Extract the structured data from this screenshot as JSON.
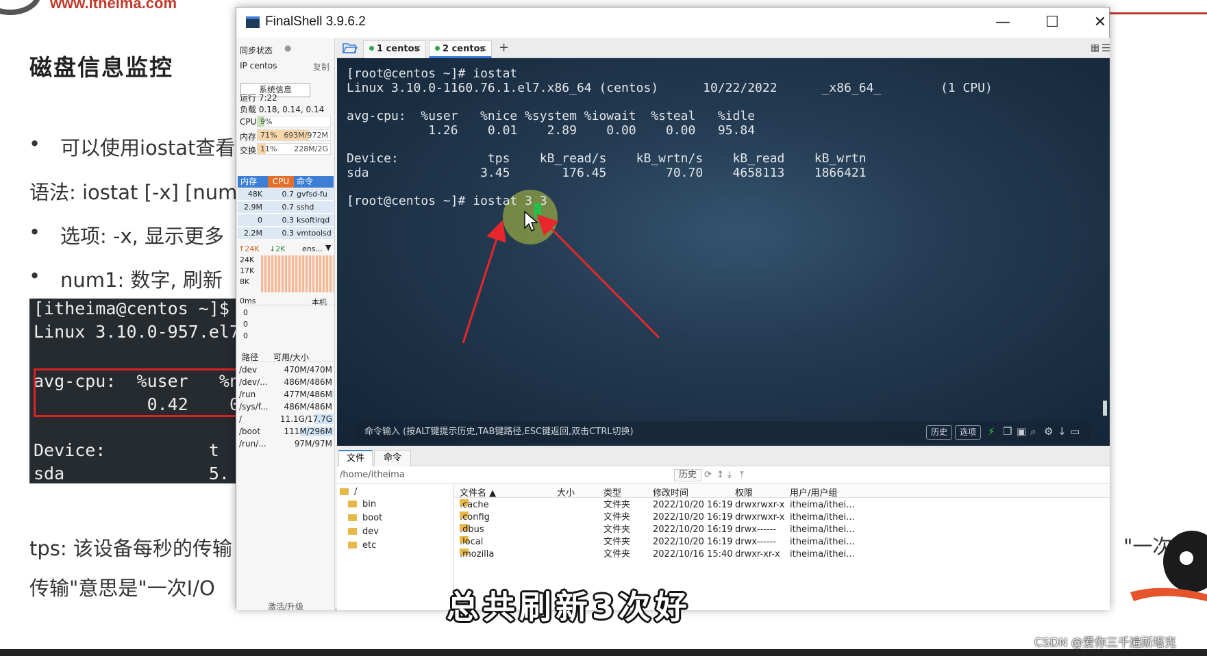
{
  "slide": {
    "logo_url": "www.itheima.com",
    "title": "磁盘信息监控",
    "bullet1": "可以使用iostat查看",
    "syntax": "语法: iostat [-x] [num",
    "bullet2": "选项: -x, 显示更多",
    "bullet3": "num1: 数字, 刷新",
    "code_line1": "[itheima@centos ~]$",
    "code_line2": "Linux 3.10.0-957.el7",
    "code_line3": "avg-cpu:  %user   %n",
    "code_line4": "           0.42    0",
    "code_line5": "Device:          t",
    "code_line6": "sda              5.",
    "tps_line": "tps: 该设备每秒的传输",
    "tps_line2": "传输\"意思是\"一次I/O",
    "right_text": "\"一次",
    "subtitle": "总共刷新3次好",
    "watermark": "CSDN @爱你三千遍斯塔克"
  },
  "window": {
    "title": "FinalShell 3.9.6.2",
    "minimize": "—",
    "maximize": "☐",
    "close": "✕"
  },
  "sidebar": {
    "sync_label": "同步状态",
    "ip_label": "IP centos",
    "copy_label": "复制",
    "sysinfo_button": "系统信息",
    "uptime": "运行 7:22",
    "load": "负载 0.18, 0.14, 0.14",
    "cpu": {
      "label": "CPU",
      "pct": "9%",
      "fraction": 0.09
    },
    "mem": {
      "label": "内存",
      "pct": "71%",
      "value": "693M/972M",
      "fraction": 0.71
    },
    "swap": {
      "label": "交换",
      "pct": "11%",
      "value": "228M/2G",
      "fraction": 0.11
    },
    "proc_headers": [
      "内存",
      "CPU",
      "命令"
    ],
    "processes": [
      {
        "mem": "48K",
        "cpu": "0.7",
        "cmd": "gvfsd-fu"
      },
      {
        "mem": "2.9M",
        "cpu": "0.7",
        "cmd": "sshd"
      },
      {
        "mem": "0",
        "cpu": "0.3",
        "cmd": "ksoftirqd"
      },
      {
        "mem": "2.2M",
        "cpu": "0.3",
        "cmd": "vmtoolsd"
      }
    ],
    "net_up": "↑24K",
    "net_down": "↓2K",
    "net_iface": "ens...",
    "net_scale": [
      "24K",
      "17K",
      "8K"
    ],
    "ping_label": "0ms",
    "ping_host": "本机",
    "ping_values": [
      "0",
      "0",
      "0"
    ],
    "disk_headers": [
      "路径",
      "可用/大小"
    ],
    "disks": [
      {
        "path": "/dev",
        "size": "470M/470M",
        "fraction": 0.0
      },
      {
        "path": "/dev/...",
        "size": "486M/486M",
        "fraction": 0.0
      },
      {
        "path": "/run",
        "size": "477M/486M",
        "fraction": 0.02
      },
      {
        "path": "/sys/f...",
        "size": "486M/486M",
        "fraction": 0.0
      },
      {
        "path": "/",
        "size": "11.1G/17.7G",
        "fraction": 0.37
      },
      {
        "path": "/boot",
        "size": "111M/296M",
        "fraction": 0.62
      },
      {
        "path": "/run/...",
        "size": "97M/97M",
        "fraction": 0.0
      }
    ],
    "activate": "激活/升级"
  },
  "tabs": [
    {
      "label": "1 centos",
      "active": false
    },
    {
      "label": "2 centos",
      "active": true
    }
  ],
  "add_tab": "+",
  "terminal": {
    "lines": [
      "[root@centos ~]# iostat",
      "Linux 3.10.0-1160.76.1.el7.x86_64 (centos)      10/22/2022      _x86_64_        (1 CPU)",
      "",
      "avg-cpu:  %user   %nice %system %iowait  %steal   %idle",
      "           1.26    0.01    2.89    0.00    0.00   95.84",
      "",
      "Device:            tps    kB_read/s    kB_wrtn/s    kB_read    kB_wrtn",
      "sda               3.45       176.45        70.70    4658113    1866421",
      "",
      "[root@centos ~]# iostat 3 3"
    ],
    "cmd_hint": "命令输入 (按ALT键提示历史,TAB键路径,ESC键返回,双击CTRL切换)",
    "history_button": "历史",
    "options_button": "选项"
  },
  "files": {
    "tab_files": "文件",
    "tab_commands": "命令",
    "path": "/home/itheima",
    "history_button": "历史",
    "tree_root": "/",
    "tree": [
      "bin",
      "boot",
      "dev",
      "etc"
    ],
    "columns": [
      "文件名 ▲",
      "大小",
      "类型",
      "修改时间",
      "权限",
      "用户/用户组"
    ],
    "rows": [
      {
        "name": ".cache",
        "size": "",
        "type": "文件夹",
        "time": "2022/10/20 16:19",
        "perm": "drwxrwxr-x",
        "owner": "itheima/ithei..."
      },
      {
        "name": ".config",
        "size": "",
        "type": "文件夹",
        "time": "2022/10/20 16:19",
        "perm": "drwxrwxr-x",
        "owner": "itheima/ithei..."
      },
      {
        "name": ".dbus",
        "size": "",
        "type": "文件夹",
        "time": "2022/10/20 16:19",
        "perm": "drwx------",
        "owner": "itheima/ithei..."
      },
      {
        "name": ".local",
        "size": "",
        "type": "文件夹",
        "time": "2022/10/20 16:19",
        "perm": "drwx------",
        "owner": "itheima/ithei..."
      },
      {
        "name": ".mozilla",
        "size": "",
        "type": "文件夹",
        "time": "2022/10/16 15:40",
        "perm": "drwxr-xr-x",
        "owner": "itheima/ithei..."
      }
    ]
  },
  "colors": {
    "accent": "#3d7fd6",
    "terminal_bg": "#233a51",
    "cursor": "#1ec24a",
    "arrow": "#e8262b",
    "brand_red": "#c0392b"
  }
}
